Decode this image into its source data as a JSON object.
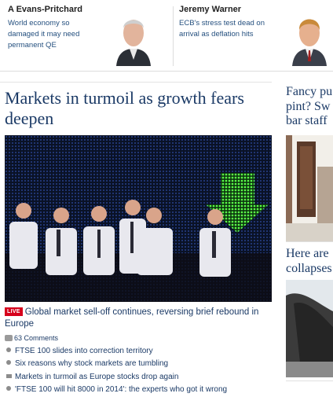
{
  "columnists": [
    {
      "name": "A Evans-Pritchard",
      "blurb": "World economy so damaged it may need permanent QE"
    },
    {
      "name": "Jeremy Warner",
      "blurb": "ECB's stress test dead on arrival as deflation hits"
    }
  ],
  "main_story": {
    "headline": "Markets in turmoil as growth fears deepen",
    "live_badge": "LIVE",
    "live_text": "Global market sell-off continues, reversing brief rebound in Europe",
    "comments": "63 Comments",
    "related": [
      {
        "icon": "bullet-icon",
        "text": "FTSE 100 slides into correction territory"
      },
      {
        "icon": "bullet-icon",
        "text": "Six reasons why stock markets are tumbling"
      },
      {
        "icon": "video-camera-icon",
        "text": "Markets in turmoil as Europe stocks drop again"
      },
      {
        "icon": "bullet-icon",
        "text": "'FTSE 100 will hit 8000 in 2014': the experts who got it wrong"
      }
    ]
  },
  "right_column": [
    {
      "headline_lines": [
        "Fancy pu",
        "pint? Sw",
        "bar staff"
      ]
    },
    {
      "headline_lines": [
        "Here are",
        "collapses"
      ]
    }
  ],
  "colors": {
    "link": "#1b3a66",
    "live": "#d6001c",
    "arrow": "#39e639"
  }
}
